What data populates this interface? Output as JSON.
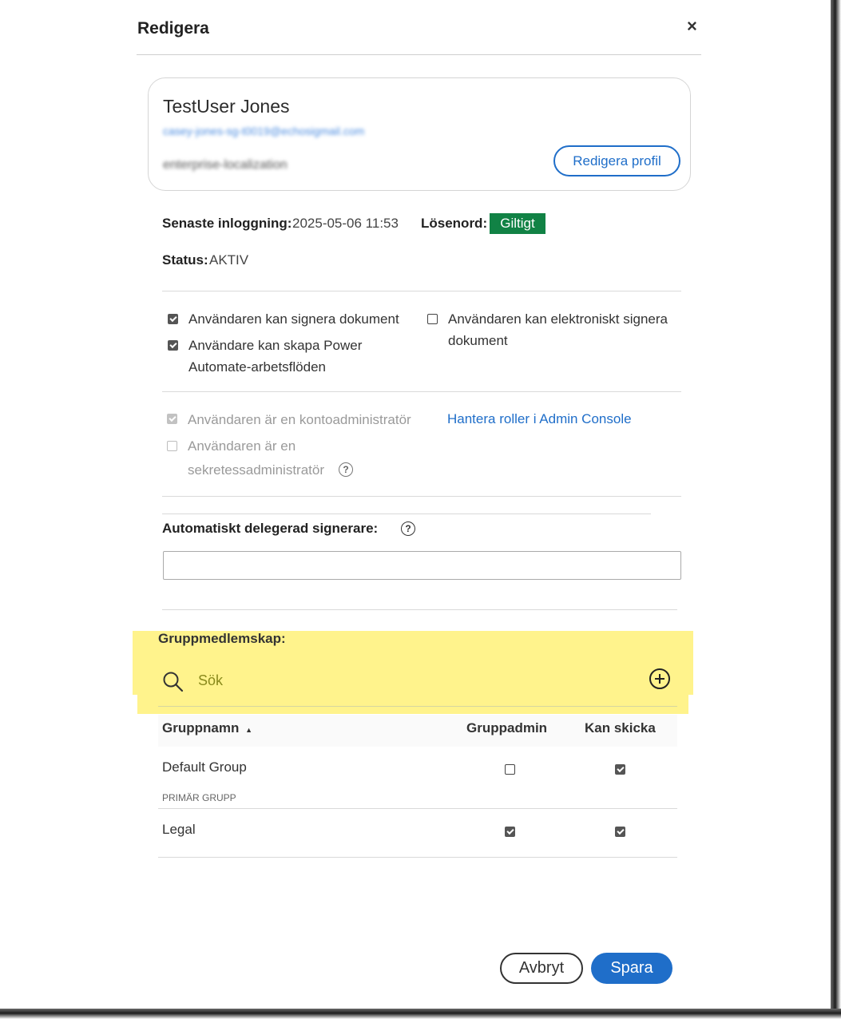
{
  "dialog": {
    "title": "Redigera",
    "close_glyph": "×"
  },
  "user": {
    "name": "TestUser Jones",
    "email": "casey-jones-sg-t0019@echosigmail.com",
    "org": "enterprise-localization",
    "edit_profile_label": "Redigera profil"
  },
  "info": {
    "last_login_label": "Senaste inloggning:",
    "last_login_value": "2025-05-06 11:53",
    "password_label": "Lösenord:",
    "password_status": "Giltigt",
    "status_label": "Status:",
    "status_value": "AKTIV"
  },
  "permissions": [
    {
      "label": "Användaren kan signera dokument",
      "checked": true
    },
    {
      "label_line1": "Användare kan skapa Power",
      "label_line2": "Automate-arbetsflöden",
      "checked": true
    },
    {
      "label_line1": "Användaren kan elektroniskt signera",
      "label_line2": "dokument",
      "checked": false
    }
  ],
  "roles": {
    "account_admin_label": "Användaren är en kontoadministratör",
    "account_admin_checked": true,
    "privacy_admin_line1": "Användaren är en",
    "privacy_admin_line2": "sekretessadministratör",
    "privacy_admin_checked": false,
    "manage_roles_link": "Hantera roller i Admin Console"
  },
  "delegate": {
    "label": "Automatiskt delegerad signerare:",
    "value": ""
  },
  "groups": {
    "title": "Gruppmedlemskap:",
    "search_placeholder": "Sök",
    "columns": {
      "name": "Gruppnamn",
      "sort_glyph": "▲",
      "admin": "Gruppadmin",
      "can_send": "Kan skicka"
    },
    "rows": [
      {
        "name": "Default Group",
        "sub": "PRIMÄR GRUPP",
        "admin": false,
        "can_send": true
      },
      {
        "name": "Legal",
        "sub": "",
        "admin": true,
        "can_send": true
      }
    ]
  },
  "footer": {
    "cancel_label": "Avbryt",
    "save_label": "Spara"
  },
  "colors": {
    "accent": "#1f6ec9",
    "valid_badge": "#118245",
    "highlight": "#fff38c"
  },
  "icons": [
    "close-icon",
    "checkbox-icon",
    "help-icon",
    "search-icon",
    "add-circle-icon",
    "sort-ascending-icon"
  ]
}
